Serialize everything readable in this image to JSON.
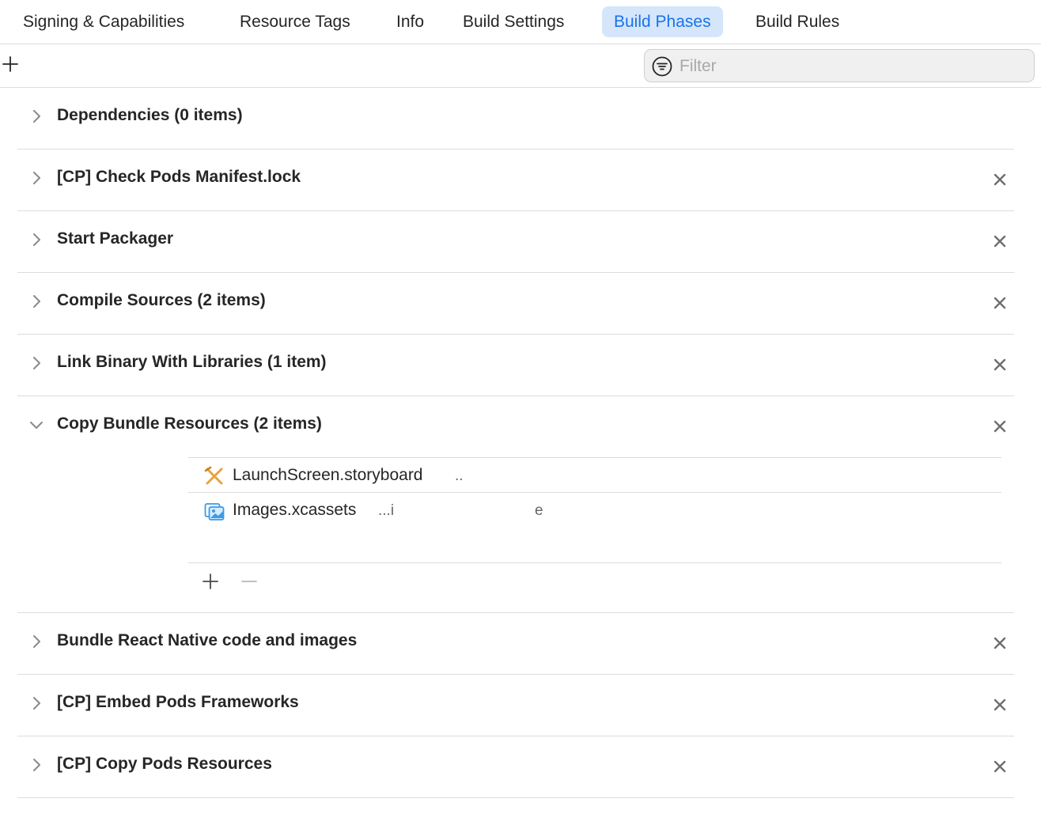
{
  "tabs": [
    {
      "label": "Signing & Capabilities",
      "active": false
    },
    {
      "label": "Resource Tags",
      "active": false
    },
    {
      "label": "Info",
      "active": false
    },
    {
      "label": "Build Settings",
      "active": false
    },
    {
      "label": "Build Phases",
      "active": true
    },
    {
      "label": "Build Rules",
      "active": false
    }
  ],
  "toolbar": {
    "add_icon": "plus-icon",
    "filter_icon": "filter-icon",
    "filter_placeholder": "Filter",
    "filter_value": ""
  },
  "phases": [
    {
      "title": "Dependencies (0 items)",
      "expanded": false,
      "removable": false
    },
    {
      "title": "[CP] Check Pods Manifest.lock",
      "expanded": false,
      "removable": true
    },
    {
      "title": "Start Packager",
      "expanded": false,
      "removable": true
    },
    {
      "title": "Compile Sources (2 items)",
      "expanded": false,
      "removable": true
    },
    {
      "title": "Link Binary With Libraries (1 item)",
      "expanded": false,
      "removable": true
    },
    {
      "title": "Copy Bundle Resources (2 items)",
      "expanded": true,
      "removable": true,
      "files": [
        {
          "name": "LaunchScreen.storyboard",
          "extra": "..",
          "icon": "storyboard-icon"
        },
        {
          "name": "Images.xcassets",
          "extra": "...i",
          "extra2": "e",
          "icon": "asset-catalog-icon"
        }
      ]
    },
    {
      "title": "Bundle React Native code and images",
      "expanded": false,
      "removable": true
    },
    {
      "title": "[CP] Embed Pods Frameworks",
      "expanded": false,
      "removable": true
    },
    {
      "title": "[CP] Copy Pods Resources",
      "expanded": false,
      "removable": true
    }
  ],
  "colors": {
    "accent": "#1a73e8",
    "active_tab_bg": "#d5e6fb",
    "separator": "#dcdcdc",
    "storyboard_icon": "#e8a33a",
    "asset_icon": "#3b9be8"
  }
}
